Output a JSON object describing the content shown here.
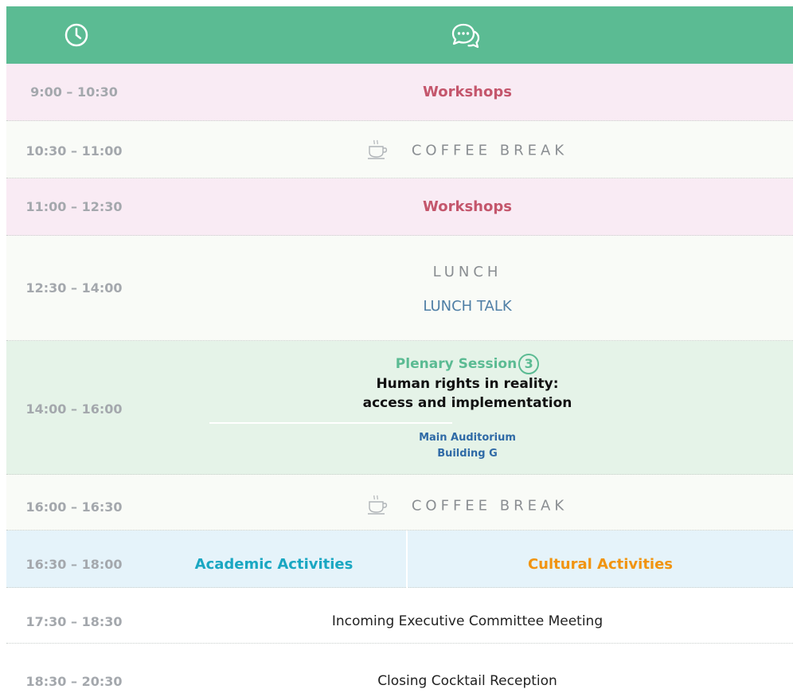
{
  "header": {
    "time_icon": "clock-icon",
    "event_icon": "speech-bubbles-icon",
    "color": "#5bbb93"
  },
  "rows": [
    {
      "time": "9:00 – 10:30",
      "event": "Workshops"
    },
    {
      "time": "10:30 – 11:00",
      "event": "COFFEE BREAK",
      "icon": "coffee-cup-icon"
    },
    {
      "time": "11:00 – 12:30",
      "event": "Workshops"
    },
    {
      "time": "12:30 – 14:00",
      "event": "LUNCH",
      "subevent": "LUNCH TALK"
    },
    {
      "time": "14:00 – 16:00",
      "event": "Plenary Session",
      "session_number": "3",
      "title_line1": "Human rights in reality:",
      "title_line2": "access and implementation",
      "venue_line1": "Main Auditorium",
      "venue_line2": "Building G"
    },
    {
      "time": "16:00 – 16:30",
      "event": "COFFEE BREAK",
      "icon": "coffee-cup-icon"
    },
    {
      "time": "16:30 – 18:00",
      "event_left": "Academic Activities",
      "event_right": "Cultural Activities"
    },
    {
      "time": "17:30 – 18:30",
      "event": "Incoming Executive Committee Meeting"
    },
    {
      "time": "18:30 – 20:30",
      "event": "Closing Cocktail Reception"
    }
  ],
  "colors": {
    "workshop": "#c4566c",
    "plenary": "#5bbb93",
    "academic": "#1aa7c2",
    "cultural": "#f19410",
    "lunch_talk": "#4f7fa6",
    "venue": "#2f6aa6"
  }
}
